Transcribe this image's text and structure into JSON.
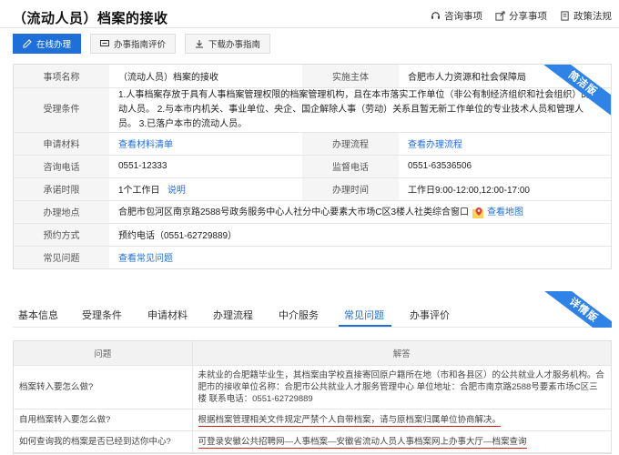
{
  "header": {
    "title": "（流动人员）档案的接收",
    "actions": [
      "咨询事项",
      "分享事项",
      "政策法规"
    ]
  },
  "buttons": {
    "online": "在线办理",
    "rating": "办事指南评价",
    "download": "下载办事指南"
  },
  "ribbons": {
    "simple": "简洁版",
    "detail": "详情版"
  },
  "info": {
    "item_name_label": "事项名称",
    "item_name": "（流动人员）档案的接收",
    "subject_label": "实施主体",
    "subject": "合肥市人力资源和社会保障局",
    "conditions_label": "受理条件",
    "conditions": "1.人事档案存放于具有人事档案管理权限的档案管理机构，且在本市落实工作单位（非公有制经济组织和社会组织）的流动人员。 2.与本市内机关、事业单位、央企、国企解除人事（劳动）关系且暂无新工作单位的专业技术人员和管理人员。 3.已落户本市的流动人员。",
    "materials_label": "申请材料",
    "materials_link": "查看材料清单",
    "process_label": "办理流程",
    "process_link": "查看办理流程",
    "phone_label": "咨询电话",
    "phone": "0551-12333",
    "supervise_label": "监督电话",
    "supervise": "0551-63536506",
    "deadline_label": "承诺时限",
    "deadline": "1个工作日",
    "deadline_link": "说明",
    "hours_label": "办理时间",
    "hours": "工作日9:00-12:00,12:00-17:00",
    "address_label": "办理地点",
    "address": "合肥市包河区南京路2588号政务服务中心人社分中心要素大市场C区3楼人社类综合窗口",
    "map_link": "查看地图",
    "booking_label": "预约方式",
    "booking": "预约电话（0551-62729889）",
    "faq_label": "常见问题",
    "faq_link": "查看常见问题"
  },
  "tabs": [
    "基本信息",
    "受理条件",
    "申请材料",
    "办理流程",
    "中介服务",
    "常见问题",
    "办事评价"
  ],
  "active_tab": "常见问题",
  "faq": {
    "col_question": "问题",
    "col_answer": "解答",
    "rows": [
      {
        "q": "档案转入要怎么做?",
        "a": "未就业的合肥籍毕业生，其档案由学校直接寄回原户籍所在地（市和各县区）的公共就业人才服务机构。合肥市的接收单位名称：合肥市公共就业人才服务管理中心 单位地址：合肥市南京路2588号要素市场C区三楼 联系电话：0551-62729889"
      },
      {
        "q": "自用档案转入要怎么做?",
        "a": "根据档案管理相关文件规定严禁个人自带档案，请与原档案归属单位协商解决。"
      },
      {
        "q": "如何查询我的档案是否已经到达你中心?",
        "a": "可登录安徽公共招聘网—人事档案—安徽省流动人员人事档案网上办事大厅—档案查询"
      }
    ]
  }
}
